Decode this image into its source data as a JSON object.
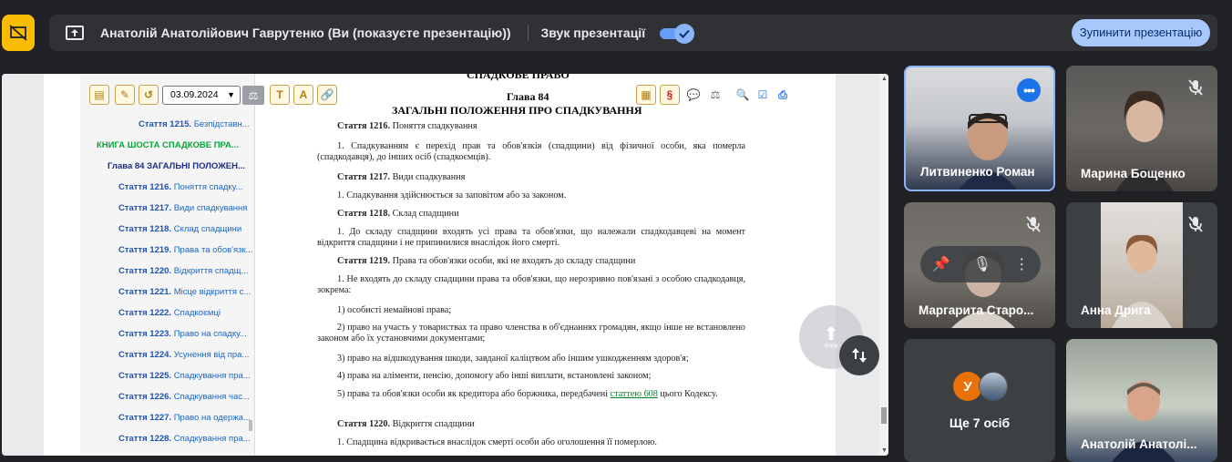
{
  "topbar": {
    "presenter_text": "Анатолій Анатолійович Гаврутенко (Ви (показуєте презентацію))",
    "sound_label": "Звук презентації",
    "sound_on": true,
    "stop_button_label": "Зупинити презентацію",
    "accent_color": "#fbbc04"
  },
  "document": {
    "toolbar": {
      "date_value": "03.09.2024"
    },
    "book_heading": "СПАДКОВЕ ПРАВО",
    "chapter": "Глава 84",
    "chapter_title": "ЗАГАЛЬНІ ПОЛОЖЕННЯ ПРО СПАДКУВАННЯ",
    "nav": [
      {
        "num": "Стаття 1215.",
        "text": " Безпідставн..."
      },
      {
        "text": "КНИГА ШОСТА СПАДКОВЕ ПРА..."
      },
      {
        "text": "Глава 84 ЗАГАЛЬНІ ПОЛОЖЕН..."
      },
      {
        "num": "Стаття 1216.",
        "text": " Поняття спадку..."
      },
      {
        "num": "Стаття 1217.",
        "text": " Види спадкування"
      },
      {
        "num": "Стаття 1218.",
        "text": " Склад спадщини"
      },
      {
        "num": "Стаття 1219.",
        "text": " Права та обов'язк..."
      },
      {
        "num": "Стаття 1220.",
        "text": " Відкриття спадщ..."
      },
      {
        "num": "Стаття 1221.",
        "text": " Місце відкриття с..."
      },
      {
        "num": "Стаття 1222.",
        "text": " Спадкоємці"
      },
      {
        "num": "Стаття 1223.",
        "text": " Право на спадку..."
      },
      {
        "num": "Стаття 1224.",
        "text": " Усунення від пра..."
      },
      {
        "num": "Стаття 1225.",
        "text": " Спадкування пра..."
      },
      {
        "num": "Стаття 1226.",
        "text": " Спадкування час..."
      },
      {
        "num": "Стаття 1227.",
        "text": " Право на одержа..."
      },
      {
        "num": "Стаття 1228.",
        "text": " Спадкування пра..."
      }
    ],
    "body": [
      {
        "bold": "Стаття 1216.",
        "text": " Поняття спадкування"
      },
      {
        "text": "1. Спадкуванням є перехід прав та обов'язків (спадщини) від фізичної особи, яка померла (спадкодавця), до інших осіб (спадкоємців)."
      },
      {
        "bold": "Стаття 1217.",
        "text": " Види спадкування"
      },
      {
        "text": "1. Спадкування здійснюється за заповітом або за законом."
      },
      {
        "bold": "Стаття 1218.",
        "text": " Склад спадщини"
      },
      {
        "text": "1. До складу спадщини входять усі права та обов'язки, що належали спадкодавцеві на момент відкриття спадщини і не припинилися внаслідок його смерті."
      },
      {
        "bold": "Стаття 1219.",
        "text": " Права та обов'язки особи, які не входять до складу спадщини"
      },
      {
        "text": "1. Не входять до складу спадщини права та обов'язки, що нерозривно пов'язані з особою спадкодавця, зокрема:"
      },
      {
        "text": "1) особисті немайнові права;"
      },
      {
        "text": "2) право на участь у товариствах та право членства в об'єднаннях громадян, якщо інше не встановлено законом або їх установчими документами;"
      },
      {
        "text": "3) право на відшкодування шкоди, завданої каліцтвом або іншим ушкодженням здоров'я;"
      },
      {
        "text": "4) права на аліменти, пенсію, допомогу або інші виплати, встановлені законом;"
      },
      {
        "text": "5) права та обов'язки особи як кредитора або боржника, передбачені ",
        "link": "статтею 608",
        "tail": " цього Кодексу."
      },
      {
        "bold": "Стаття 1220.",
        "text": " Відкриття спадщини"
      },
      {
        "text": "1. Спадщина відкривається внаслідок смерті особи або оголошення її померлою."
      }
    ],
    "fab_label": "вгору"
  },
  "participants": [
    {
      "name": "Литвиненко Роман"
    },
    {
      "name": "Марина Бощенко"
    },
    {
      "name": "Маргарита Старо..."
    },
    {
      "name": "Анна Дрига"
    },
    {
      "avatar_letter": "У",
      "others_label": "Ще 7 осіб"
    },
    {
      "name": "Анатолій Анатолі..."
    }
  ]
}
